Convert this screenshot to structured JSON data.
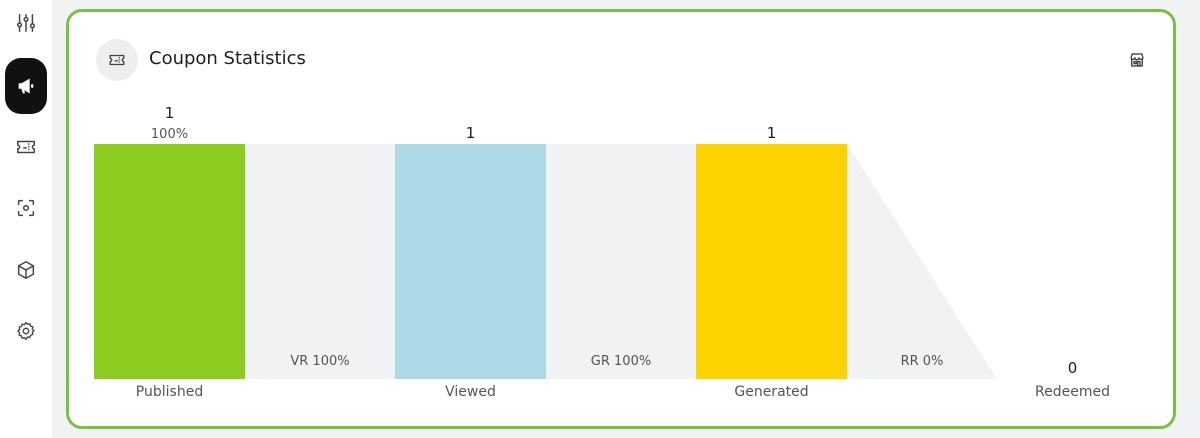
{
  "sidebar": {
    "items": [
      {
        "name": "sliders-icon",
        "active": false
      },
      {
        "name": "megaphone-icon",
        "active": true
      },
      {
        "name": "ticket-icon",
        "active": false
      },
      {
        "name": "scan-icon",
        "active": false
      },
      {
        "name": "cube-icon",
        "active": false
      },
      {
        "name": "gear-icon",
        "active": false
      }
    ]
  },
  "card": {
    "title": "Coupon Statistics",
    "title_icon": "ticket-icon",
    "action_icon": "store-icon",
    "border_color": "#7ac143"
  },
  "chart_data": {
    "type": "bar",
    "categories": [
      "Published",
      "Viewed",
      "Generated",
      "Redeemed"
    ],
    "values": [
      1,
      1,
      1,
      0
    ],
    "published_percent": "100%",
    "colors": [
      "#8dcc1f",
      "#add8e6",
      "#ffd300",
      "#cccccc"
    ],
    "rates": [
      "VR 100%",
      "GR 100%",
      "RR 0%"
    ],
    "ylim": [
      0,
      1
    ]
  }
}
